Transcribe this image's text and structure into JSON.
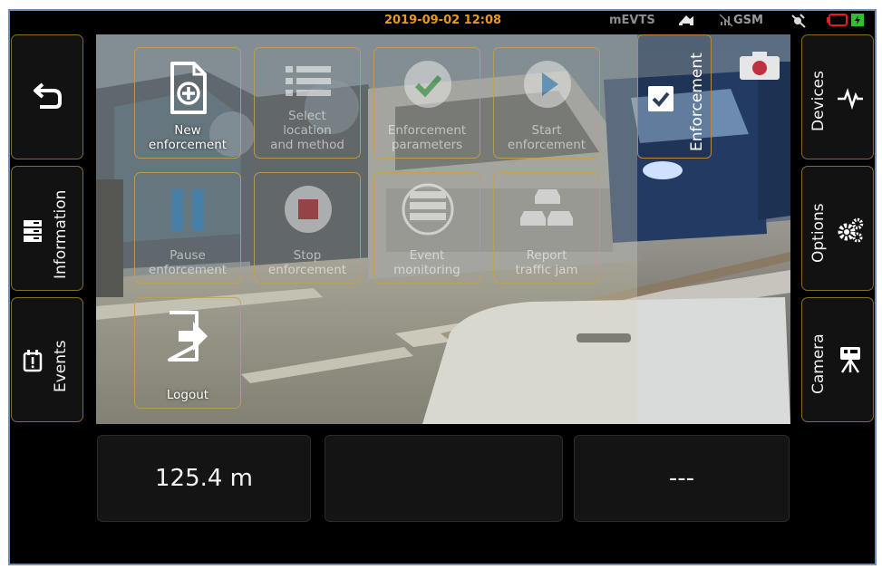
{
  "status": {
    "datetime": "2019-09-02 12:08",
    "app_name": "mEVTS",
    "gsm": "GSM",
    "colors": {
      "datetime": "#e79a1e",
      "battery_low": "#e02020",
      "battery_charge": "#2fbf2f"
    }
  },
  "left_nav": {
    "back_icon": "back-arrow-icon",
    "information_label": "Information",
    "events_label": "Events"
  },
  "right_nav": {
    "devices_label": "Devices",
    "options_label": "Options",
    "camera_label": "Camera"
  },
  "menu": {
    "tiles": [
      {
        "label": "New\nenforcement",
        "icon": "new-document-icon",
        "enabled": true
      },
      {
        "label": "Select\nlocation\nand method",
        "icon": "list-icon",
        "enabled": false
      },
      {
        "label": "Enforcement\nparameters",
        "icon": "check-circle-icon",
        "enabled": false
      },
      {
        "label": "Start\nenforcement",
        "icon": "play-icon",
        "enabled": false
      },
      {
        "label": "Pause\nenforcement",
        "icon": "pause-icon",
        "enabled": false
      },
      {
        "label": "Stop\nenforcement",
        "icon": "stop-icon",
        "enabled": false
      },
      {
        "label": "Event\nmonitoring",
        "icon": "monitor-icon",
        "enabled": false
      },
      {
        "label": "Report\ntraffic jam",
        "icon": "traffic-jam-icon",
        "enabled": false
      },
      {
        "label": "Logout",
        "icon": "logout-icon",
        "enabled": true
      }
    ],
    "enforcement_toggle_label": "Enforcement",
    "enforcement_checked": true
  },
  "info_boxes": {
    "distance": "125.4 m",
    "middle": "",
    "right": "---"
  }
}
